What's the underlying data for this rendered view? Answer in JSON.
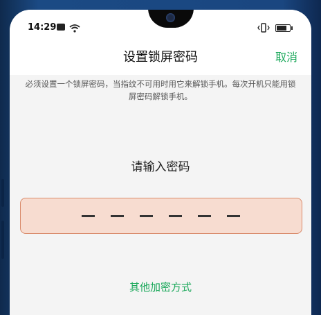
{
  "statusbar": {
    "time": "14:29",
    "icons": [
      "sim-icon",
      "wifi-icon",
      "vibrate-icon",
      "battery-icon"
    ]
  },
  "header": {
    "title": "设置锁屏密码",
    "cancel_label": "取消"
  },
  "description": "必须设置一个锁屏密码，当指纹不可用时用它来解锁手机。每次开机只能用锁屏密码解锁手机。",
  "prompt": "请输入密码",
  "pin": {
    "length": 6,
    "entered": 0
  },
  "other_methods_label": "其他加密方式",
  "colors": {
    "accent": "#1aa85a",
    "pin_box_fill": "#f7dcd0",
    "pin_box_border": "#d98a6a"
  }
}
